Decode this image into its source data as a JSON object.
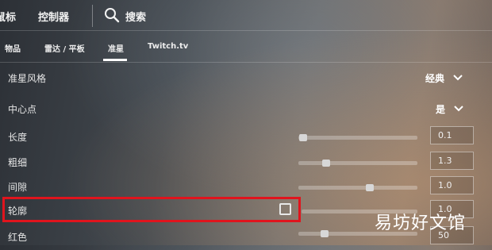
{
  "topbar": {
    "items": [
      "鼠标",
      "控制器"
    ],
    "search_label": "搜索"
  },
  "tabs": [
    {
      "label": "物品",
      "active": false
    },
    {
      "label": "雷达 / 平板",
      "active": false
    },
    {
      "label": "准星",
      "active": true
    },
    {
      "label": "Twitch.tv",
      "active": false
    }
  ],
  "settings": {
    "crosshair_style": {
      "label": "准星风格",
      "value": "经典"
    },
    "center_dot": {
      "label": "中心点",
      "value": "是"
    },
    "length": {
      "label": "长度",
      "value": "0.1",
      "slider_fraction": 0.04
    },
    "thickness": {
      "label": "粗细",
      "value": "1.3",
      "slider_fraction": 0.23
    },
    "gap": {
      "label": "间隙",
      "value": "1.0",
      "slider_fraction": 0.6
    },
    "outline": {
      "label": "轮廓",
      "checked": false,
      "value": "1.0"
    },
    "red": {
      "label": "红色",
      "value": "50",
      "slider_fraction": 0.22
    }
  },
  "watermark": "易坊好文馆",
  "colors": {
    "highlight": "#e0141d",
    "active_tab_underline": "#ffffff"
  }
}
